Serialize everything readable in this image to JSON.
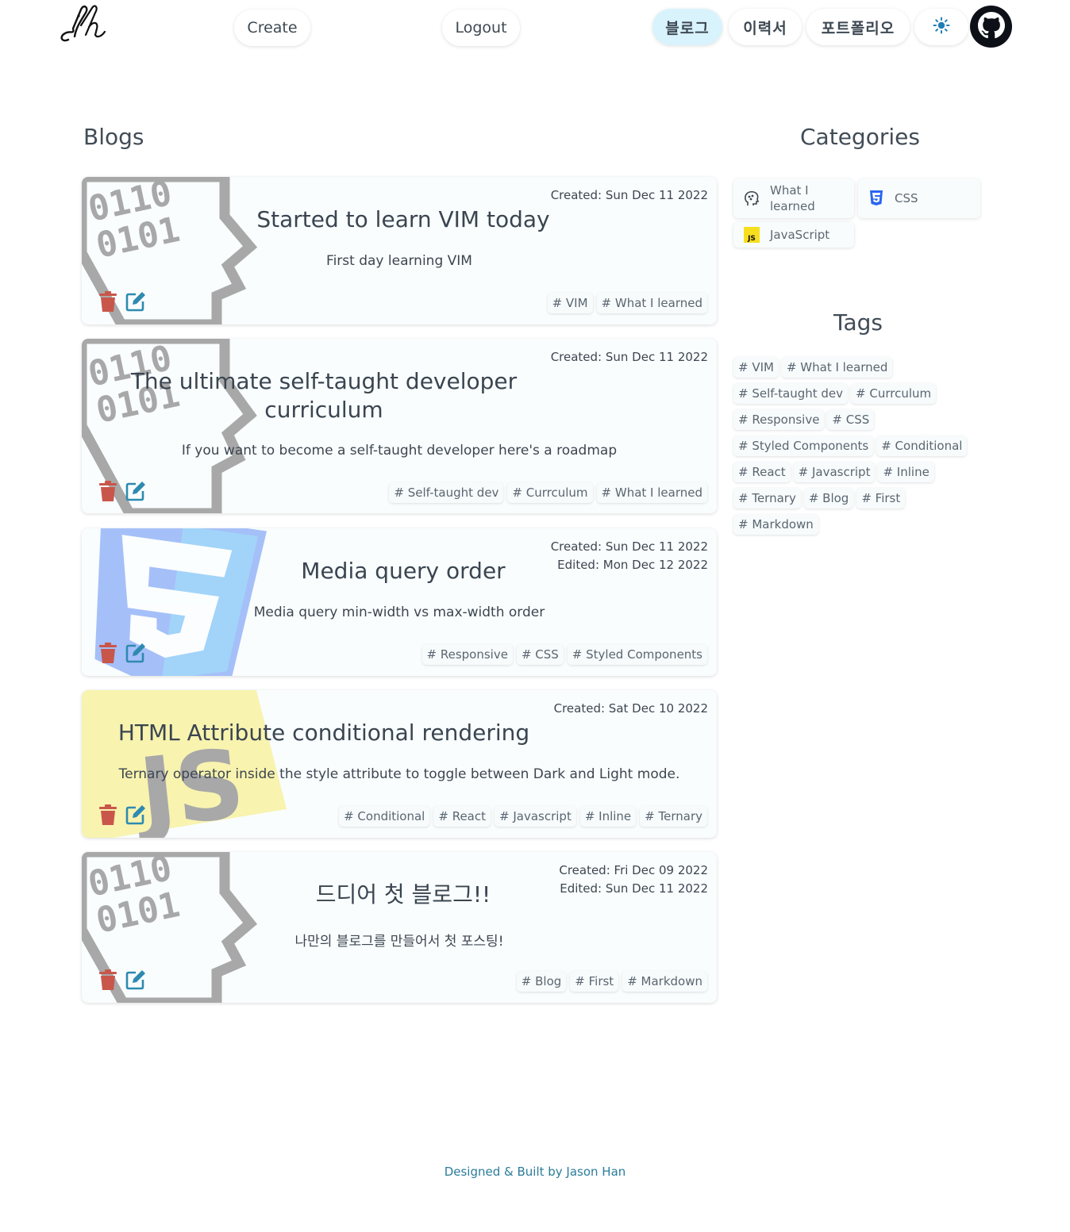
{
  "header": {
    "logo_text": "jh",
    "create_label": "Create",
    "logout_label": "Logout",
    "nav": {
      "blog": "블로그",
      "resume": "이력서",
      "portfolio": "포트폴리오"
    },
    "theme_icon": "sun-icon",
    "github_icon": "github-icon"
  },
  "headings": {
    "blogs": "Blogs",
    "categories": "Categories",
    "tags": "Tags"
  },
  "posts": [
    {
      "title": "Started to learn VIM today",
      "description": "First day learning VIM",
      "created": "Created: Sun Dec 11 2022",
      "edited": "",
      "image": "binary-head",
      "tags": [
        "# VIM",
        "# What I learned"
      ]
    },
    {
      "title": "The ultimate self-taught developer curriculum",
      "description": "If you want to become a self-taught developer here's a roadmap",
      "created": "Created: Sun Dec 11 2022",
      "edited": "",
      "image": "binary-head",
      "tags": [
        "# Self-taught dev",
        "# Currculum",
        "# What I learned"
      ]
    },
    {
      "title": "Media query order",
      "description": "Media query min-width vs max-width order",
      "created": "Created: Sun Dec 11 2022",
      "edited": "Edited: Mon Dec 12 2022",
      "image": "css-logo",
      "tags": [
        "# Responsive",
        "# CSS",
        "# Styled Components"
      ]
    },
    {
      "title": "HTML Attribute conditional rendering",
      "description": "Ternary operator inside the style attribute to toggle between Dark and Light mode.",
      "created": "Created: Sat Dec 10 2022",
      "edited": "",
      "image": "js-logo",
      "image_text": "JS",
      "tags": [
        "# Conditional",
        "# React",
        "# Javascript",
        "# Inline",
        "# Ternary"
      ]
    },
    {
      "title": "드디어 첫 블로그!!",
      "description": "나만의 블로그를 만들어서 첫 포스팅!",
      "created": "Created: Fri Dec 09 2022",
      "edited": "Edited: Sun Dec 11 2022",
      "image": "binary-head",
      "tags": [
        "# Blog",
        "# First",
        "# Markdown"
      ]
    }
  ],
  "binary_text": {
    "line1": "0110",
    "line2": "0101"
  },
  "categories": [
    {
      "label": "What I learned",
      "icon": "brain-head-icon"
    },
    {
      "label": "CSS",
      "icon": "css3-icon"
    },
    {
      "label": "JavaScript",
      "icon": "js-icon",
      "icon_text": "JS"
    }
  ],
  "tag_cloud": [
    "# VIM",
    "# What I learned",
    "# Self-taught dev",
    "# Currculum",
    "# Responsive",
    "# CSS",
    "# Styled Components",
    "# Conditional",
    "# React",
    "# Javascript",
    "# Inline",
    "# Ternary",
    "# Blog",
    "# First",
    "# Markdown"
  ],
  "footer": "Designed & Built by Jason Han",
  "colors": {
    "active_nav": "#d9f3fd",
    "trash": "#c9564b",
    "edit": "#2e8ab0",
    "footer": "#2b7d9a",
    "css_blue": "#2965f1",
    "js_yellow": "#f7df1e"
  }
}
